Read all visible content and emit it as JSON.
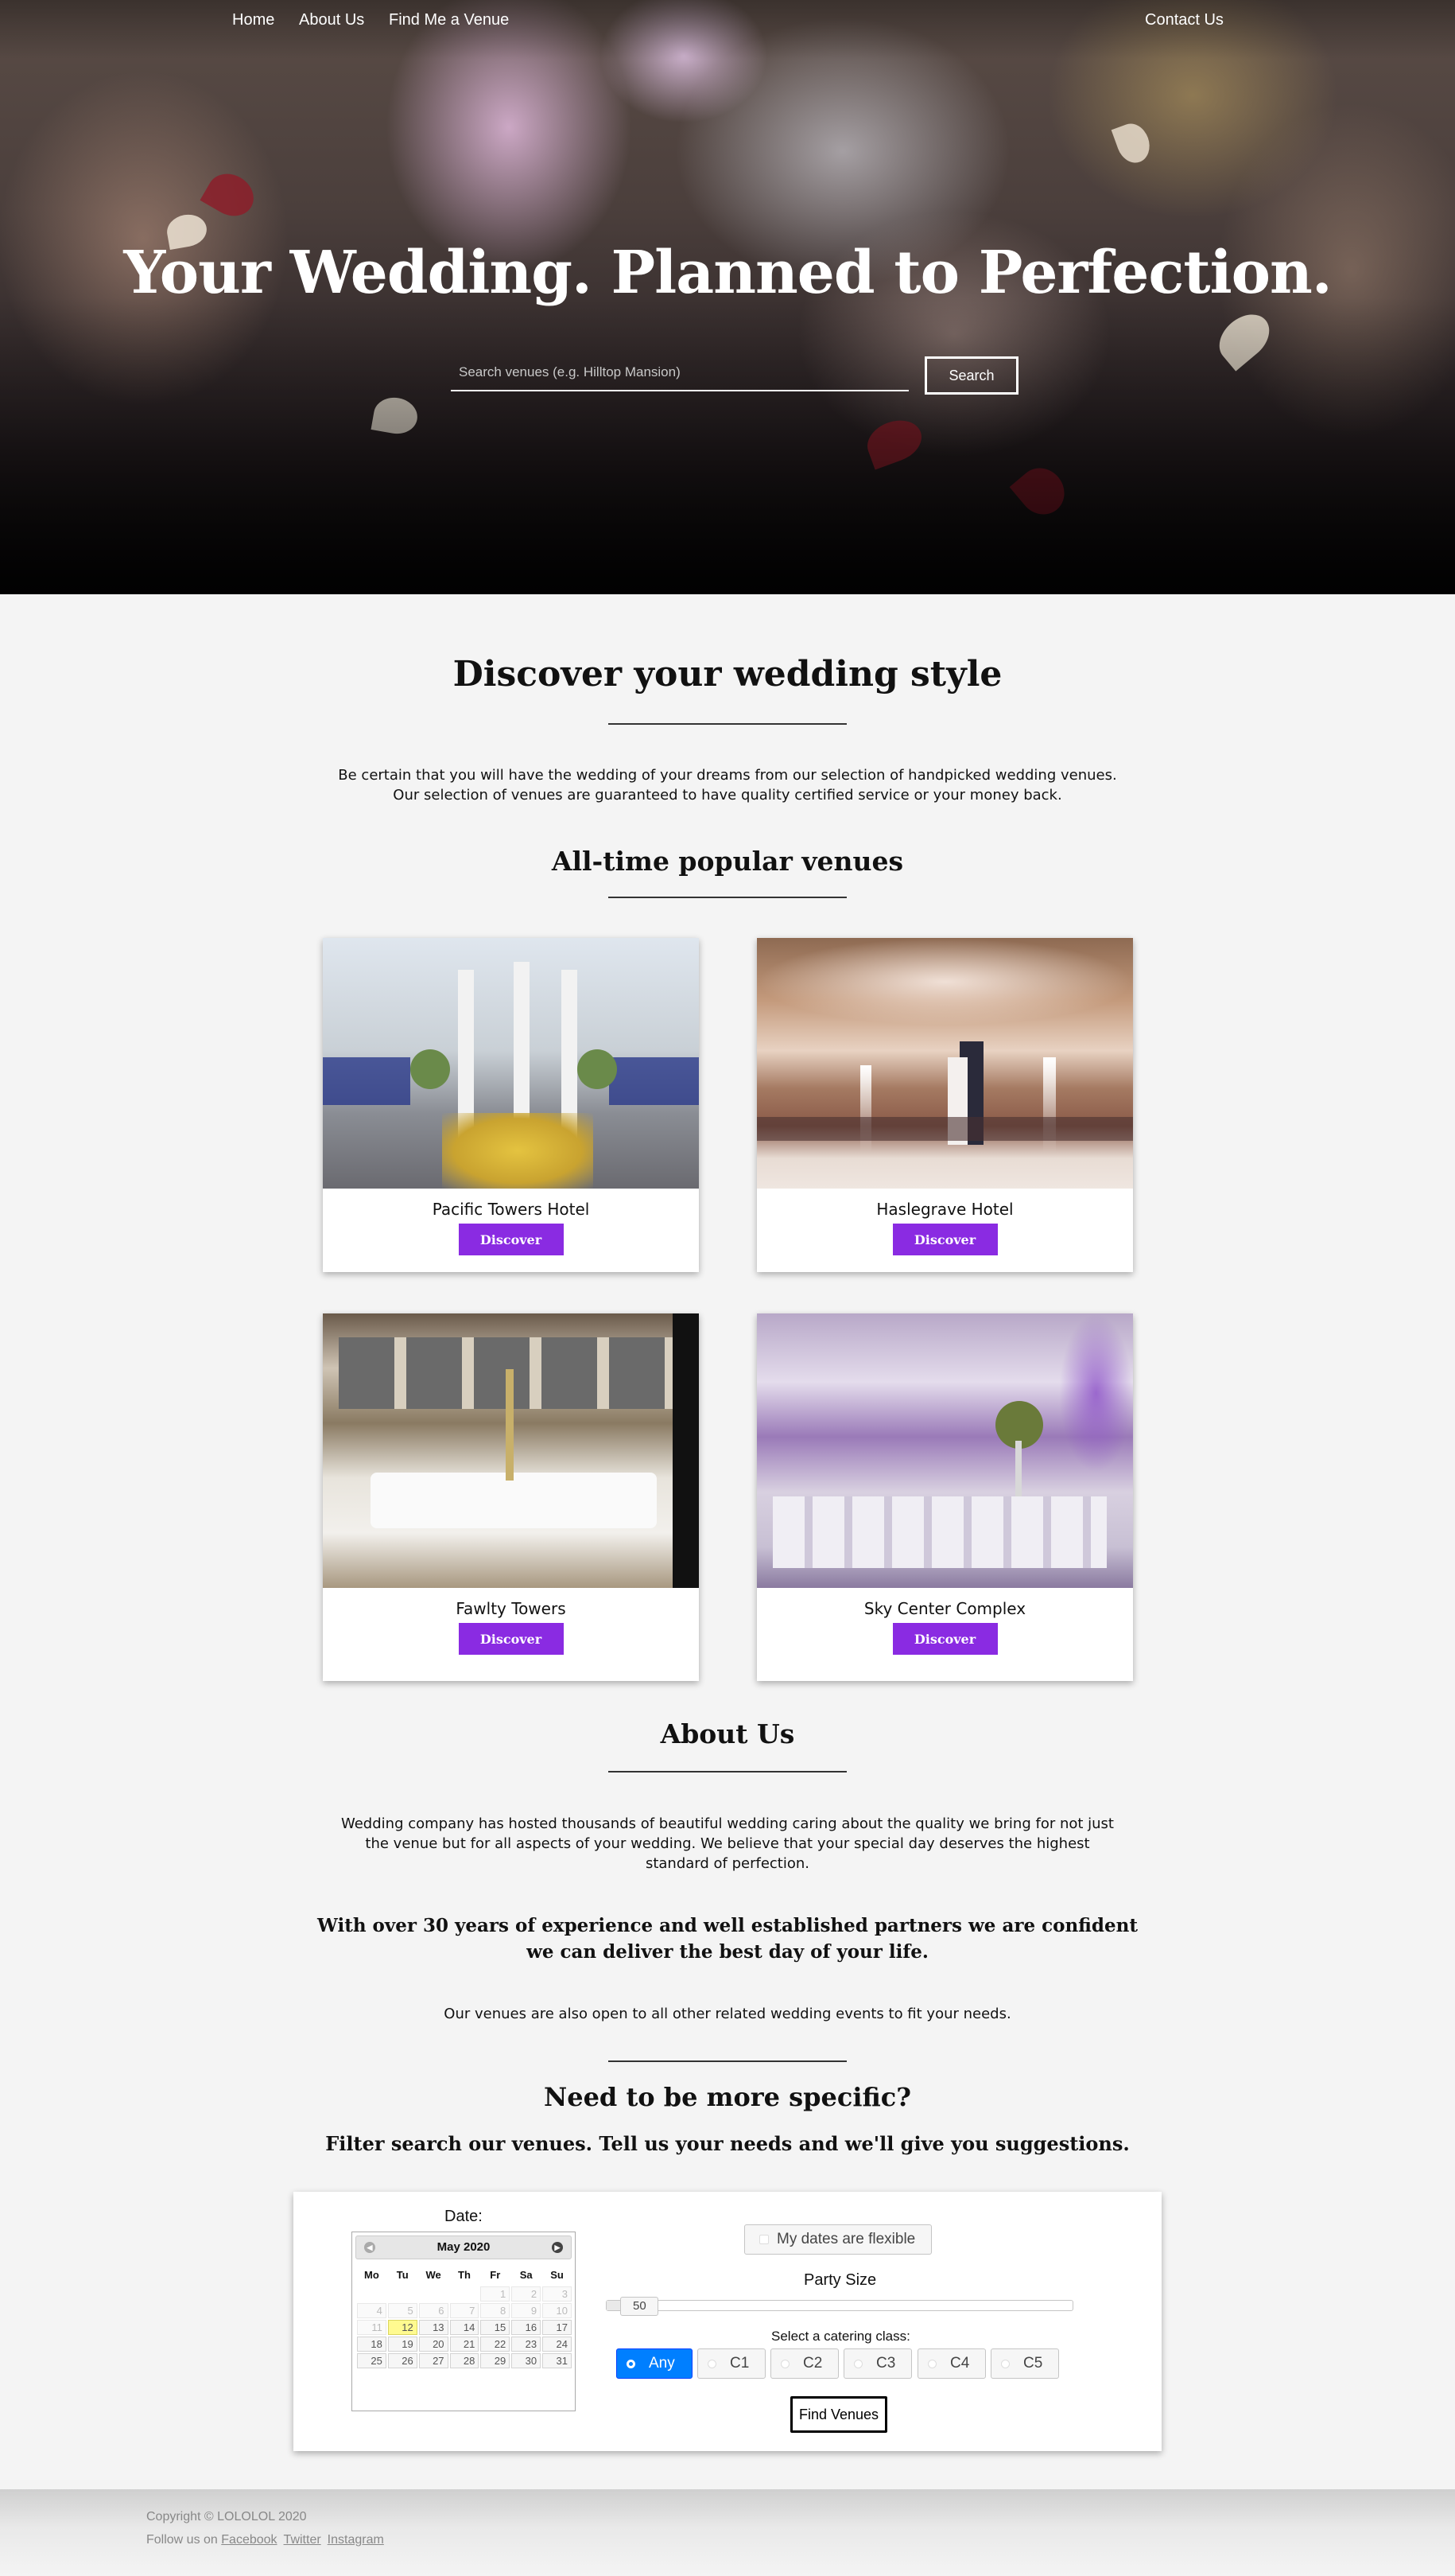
{
  "nav": {
    "items": [
      "Home",
      "About Us",
      "Find Me a Venue"
    ],
    "contact": "Contact Us"
  },
  "hero": {
    "title": "Your Wedding. Planned to Perfection.",
    "search_placeholder": "Search venues (e.g. Hilltop Mansion)",
    "search_button": "Search"
  },
  "discover": {
    "title": "Discover your wedding style",
    "text": "Be certain that you will have the wedding of your dreams from our selection of handpicked wedding venues. Our selection of venues are guaranteed to have quality certified service or your money back."
  },
  "popular": {
    "title": "All-time popular venues",
    "venues": [
      {
        "name": "Pacific Towers Hotel",
        "button": "Discover"
      },
      {
        "name": "Haslegrave Hotel",
        "button": "Discover"
      },
      {
        "name": "Fawlty Towers",
        "button": "Discover"
      },
      {
        "name": "Sky Center Complex",
        "button": "Discover"
      }
    ]
  },
  "about": {
    "title": "About Us",
    "text1": "Wedding company has hosted thousands of beautiful wedding caring about the quality we bring for not just the venue but for all aspects of your wedding. We believe that your special day deserves the highest standard of perfection.",
    "highlight": "With over 30 years of experience and well established partners we are confident we can deliver the best day of your life.",
    "text2": "Our venues are also open to all other related wedding events to fit your needs."
  },
  "specific": {
    "title": "Need to be more specific?",
    "subtitle": "Filter search our venues. Tell us your needs and we'll give you suggestions."
  },
  "filter": {
    "date_label": "Date:",
    "calendar": {
      "month": "May 2020",
      "weekdays": [
        "Mo",
        "Tu",
        "We",
        "Th",
        "Fr",
        "Sa",
        "Su"
      ],
      "weeks": [
        [
          "",
          "",
          "",
          "",
          "1",
          "2",
          "3"
        ],
        [
          "4",
          "5",
          "6",
          "7",
          "8",
          "9",
          "10"
        ],
        [
          "11",
          "12",
          "13",
          "14",
          "15",
          "16",
          "17"
        ],
        [
          "18",
          "19",
          "20",
          "21",
          "22",
          "23",
          "24"
        ],
        [
          "25",
          "26",
          "27",
          "28",
          "29",
          "30",
          "31"
        ]
      ],
      "today": "12",
      "first_enabled": 12
    },
    "flexible_label": "My dates are flexible",
    "flexible_checked": false,
    "party_size_label": "Party Size",
    "party_size": 50,
    "party_size_max": 1000,
    "catering_label": "Select a catering class:",
    "catering_options": [
      "Any",
      "C1",
      "C2",
      "C3",
      "C4",
      "C5"
    ],
    "catering_selected": "Any",
    "submit": "Find Venues"
  },
  "footer": {
    "copyright": "Copyright © LOLOLOL 2020",
    "follow": "Follow us on",
    "links": [
      "Facebook",
      "Twitter",
      "Instagram"
    ]
  },
  "colors": {
    "accent": "#8a2be2",
    "selected": "#007fff",
    "today": "#fffa90"
  }
}
